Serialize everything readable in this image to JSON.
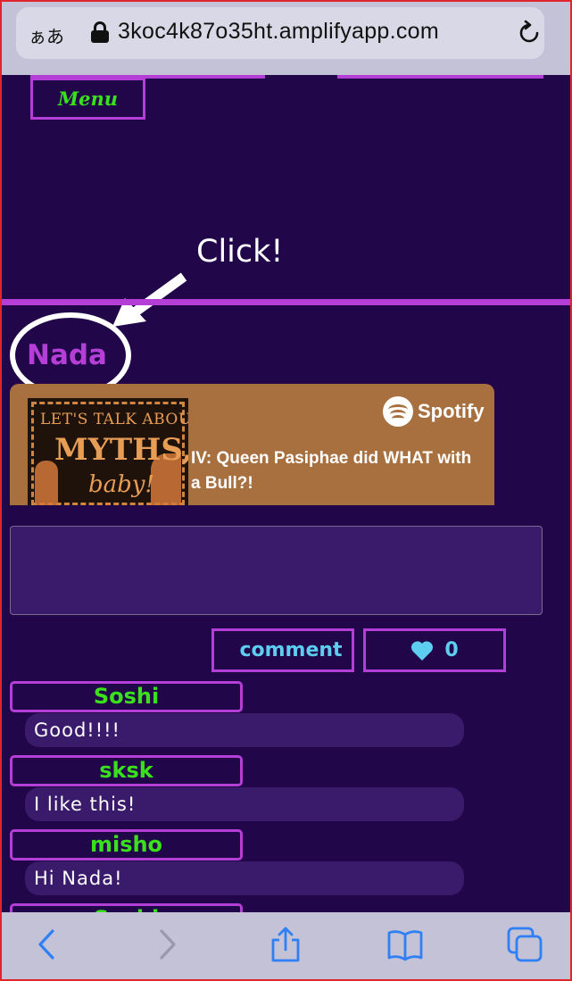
{
  "browser": {
    "text_size_label": "ぁあ",
    "url": "3koc4k87o35ht.amplifyapp.com",
    "toolbar_icons": [
      "back-icon",
      "forward-icon",
      "share-icon",
      "bookmarks-icon",
      "tabs-icon"
    ]
  },
  "header": {
    "menu_label": "Menu"
  },
  "annotation": {
    "click_label": "Click!"
  },
  "post": {
    "author": "Nada",
    "spotify": {
      "brand": "Spotify",
      "cover_line1": "LET'S TALK ABOUT",
      "cover_line2": "MYTHS,",
      "cover_line3": "baby!",
      "episode_title": "IV: Queen Pasiphae did WHAT with a Bull?!"
    },
    "comment_input_value": "",
    "comment_button": "comment",
    "like_count": "0"
  },
  "comments": [
    {
      "user": "Soshi",
      "text": "Good!!!!"
    },
    {
      "user": "sksk",
      "text": "I like this!"
    },
    {
      "user": "misho",
      "text": "Hi Nada!"
    },
    {
      "user": "Soshi",
      "text": ""
    }
  ],
  "colors": {
    "background": "#22064a",
    "accent_border": "#b53ed6",
    "username_green": "#39e01b",
    "button_text_cyan": "#5dcef0",
    "comment_bubble": "#3a1a6b",
    "spotify_card": "#a8703f"
  }
}
